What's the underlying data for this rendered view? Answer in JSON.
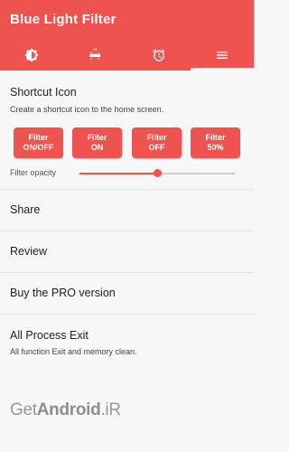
{
  "app": {
    "title": "Blue Light Filter",
    "accent_color": "#ef5350"
  },
  "tabs": [
    {
      "icon": "brightness-icon",
      "selected": false
    },
    {
      "icon": "screen-dim-icon",
      "selected": false
    },
    {
      "icon": "alarm-clock-icon",
      "selected": false
    },
    {
      "icon": "menu-icon",
      "selected": true
    }
  ],
  "shortcut": {
    "title": "Shortcut Icon",
    "subtitle": "Create a shortcut icon to the home screen.",
    "buttons": [
      {
        "line1": "Filter",
        "line2": "ON/OFF"
      },
      {
        "line1": "Filter",
        "line2": "ON"
      },
      {
        "line1": "Filter",
        "line2": "OFF"
      },
      {
        "line1": "Filter",
        "line2": "50%"
      }
    ],
    "opacity_label": "Filter opacity",
    "opacity_fraction": 0.5
  },
  "menu": {
    "share": "Share",
    "review": "Review",
    "pro": "Buy the PRO version",
    "exit_title": "All Process Exit",
    "exit_subtitle": "All function Exit and memory clean."
  },
  "watermark": {
    "part1": "Get",
    "part2": "Android",
    "part3": ".iR"
  }
}
